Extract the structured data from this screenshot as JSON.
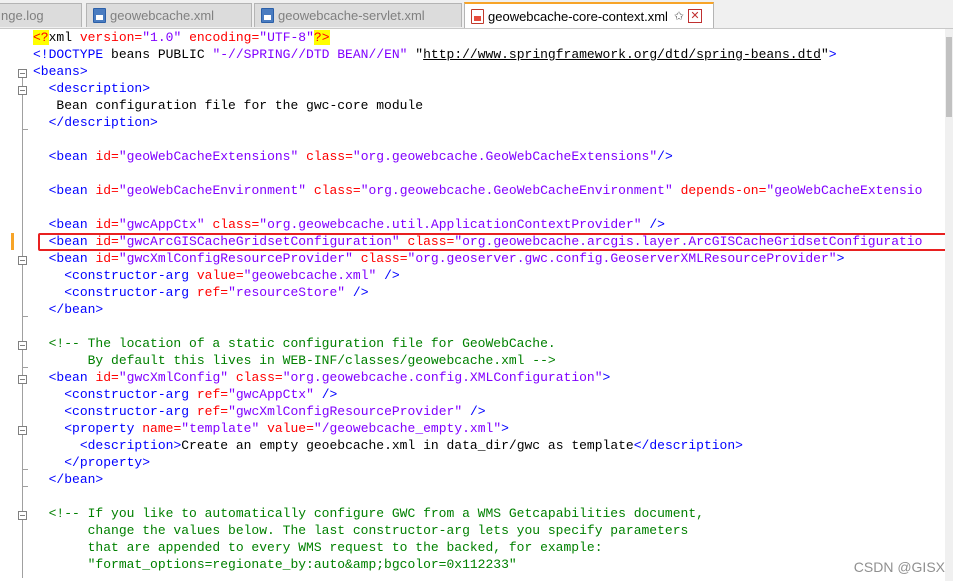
{
  "tabs": [
    {
      "label": "nge.log",
      "active": false,
      "icon": "file-icon"
    },
    {
      "label": "geowebcache.xml",
      "active": false,
      "icon": "file-icon"
    },
    {
      "label": "geowebcache-servlet.xml",
      "active": false,
      "icon": "file-icon"
    },
    {
      "label": "geowebcache-core-context.xml",
      "active": true,
      "icon": "file-icon",
      "pin": "pin-icon",
      "close": "close-icon"
    }
  ],
  "code_lines": [
    "<?xml version=\"1.0\" encoding=\"UTF-8\"?>",
    "<!DOCTYPE beans PUBLIC \"-//SPRING//DTD BEAN//EN\" \"http://www.springframework.org/dtd/spring-beans.dtd\">",
    "<beans>",
    "  <description>",
    "   Bean configuration file for the gwc-core module",
    "  </description>",
    "",
    "  <bean id=\"geoWebCacheExtensions\" class=\"org.geowebcache.GeoWebCacheExtensions\"/>",
    "",
    "  <bean id=\"geoWebCacheEnvironment\" class=\"org.geowebcache.GeoWebCacheEnvironment\" depends-on=\"geoWebCacheExtensio",
    "",
    "  <bean id=\"gwcAppCtx\" class=\"org.geowebcache.util.ApplicationContextProvider\" />",
    "  <bean id=\"gwcArcGISCacheGridsetConfiguration\" class=\"org.geowebcache.arcgis.layer.ArcGISCacheGridsetConfiguratio",
    "  <bean id=\"gwcXmlConfigResourceProvider\" class=\"org.geoserver.gwc.config.GeoserverXMLResourceProvider\">",
    "    <constructor-arg value=\"geowebcache.xml\" />",
    "    <constructor-arg ref=\"resourceStore\" />",
    "  </bean>",
    "",
    "  <!-- The location of a static configuration file for GeoWebCache.",
    "       By default this lives in WEB-INF/classes/geowebcache.xml -->",
    "  <bean id=\"gwcXmlConfig\" class=\"org.geowebcache.config.XMLConfiguration\">",
    "    <constructor-arg ref=\"gwcAppCtx\" />",
    "    <constructor-arg ref=\"gwcXmlConfigResourceProvider\" />",
    "    <property name=\"template\" value=\"/geowebcache_empty.xml\">",
    "      <description>Create an empty geoebcache.xml in data_dir/gwc as template</description>",
    "    </property>",
    "  </bean>",
    "",
    "  <!-- If you like to automatically configure GWC from a WMS Getcapabilities document,",
    "       change the values below. The last constructor-arg lets you specify parameters",
    "       that are appended to every WMS request to the backed, for example:",
    "       \"format_options=regionate_by:auto&amp;bgcolor=0x112233\""
  ],
  "highlighted_line_index": 12,
  "watermark": "CSDN @GISX",
  "colors": {
    "tag": "#0000ff",
    "attribute": "#ff0000",
    "value": "#8000ff",
    "comment": "#008000",
    "highlight_box": "#e82020",
    "active_tab_accent": "#f7a428"
  }
}
